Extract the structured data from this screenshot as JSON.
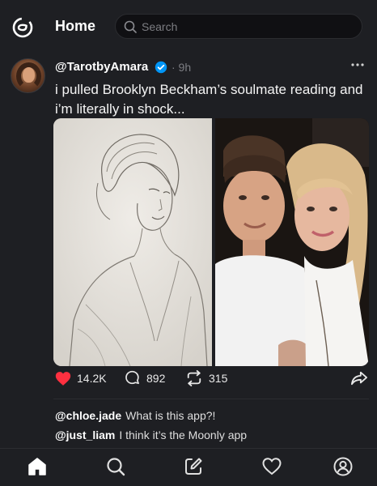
{
  "header": {
    "title": "Home",
    "search_placeholder": "Search"
  },
  "post": {
    "author": "@TarotbyAmara",
    "time": "· 9h",
    "text": "i pulled Brooklyn Beckham’s soulmate reading and i’m literally in shock...",
    "likes": "14.2K",
    "replies": "892",
    "reposts": "315"
  },
  "comments": [
    {
      "user": "@chloe.jade",
      "text": "What is this app?!"
    },
    {
      "user": "@just_liam",
      "text": "I think it’s the Moonly app"
    }
  ],
  "colors": {
    "background": "#1e1f23",
    "like_heart": "#ff3040",
    "verified_badge": "#0095f6"
  },
  "icons": {
    "logo": "threads-logo-icon",
    "search": "search-icon",
    "verified": "verified-badge-icon",
    "more": "more-dots-icon",
    "like": "heart-filled-icon",
    "reply": "comment-bubble-icon",
    "repost": "repost-icon",
    "share": "share-arrow-icon",
    "nav": [
      "home-icon",
      "search-icon",
      "compose-icon",
      "activity-heart-icon",
      "profile-icon"
    ]
  }
}
